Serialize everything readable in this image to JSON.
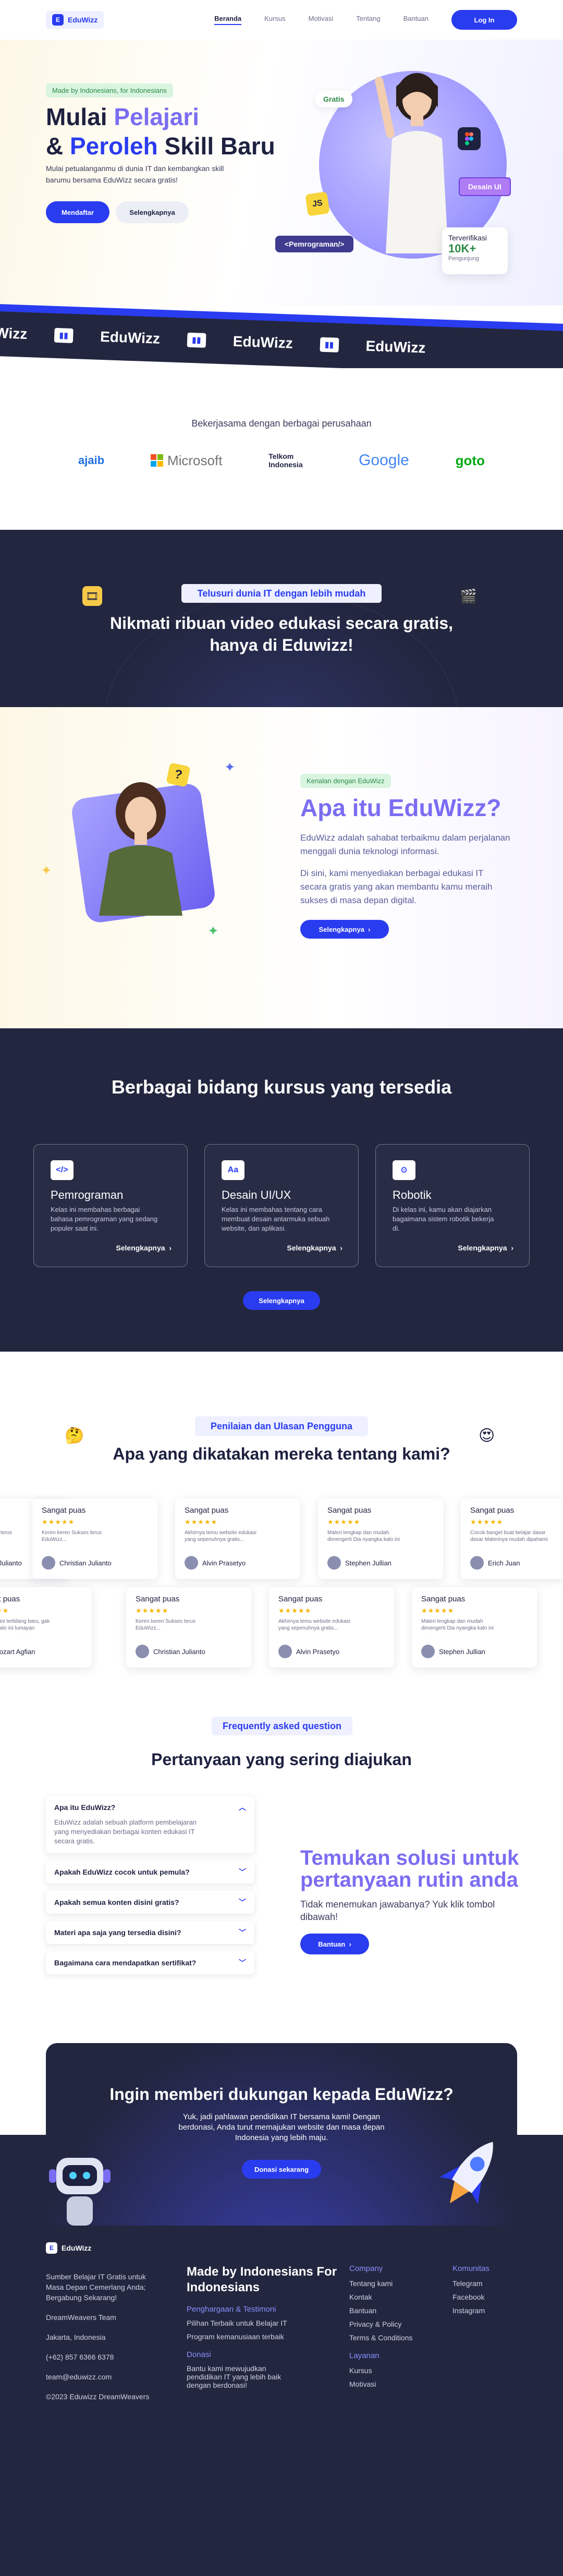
{
  "header": {
    "logo": "EduWizz",
    "nav": [
      "Beranda",
      "Kursus",
      "Motivasi",
      "Tentang",
      "Bantuan"
    ],
    "login": "Log In"
  },
  "hero": {
    "badge": "Made by Indonesians, for Indonesians",
    "title_1a": "Mulai ",
    "title_1b": "Pelajari",
    "title_2a": "& ",
    "title_2b": "Peroleh",
    "title_2c": " Skill Baru",
    "desc": "Mulai petualanganmu di dunia IT dan kembangkan skill barumu bersama EduWizz secara gratis!",
    "btn_primary": "Mendaftar",
    "btn_secondary": "Selengkapnya",
    "tag_gratis": "Gratis",
    "tag_desain": "Desain UI",
    "tag_prog": "<Pemrograman/>",
    "tag_js": "JS",
    "verif_title": "Terverifikasi",
    "verif_number": "10K+",
    "verif_sub": "Pengunjung"
  },
  "band": {
    "word": "EduWizz",
    "partial_left": "Wizz"
  },
  "partners": {
    "title": "Bekerjasama dengan berbagai perusahaan",
    "logos": [
      "ajaib",
      "Microsoft",
      "Telkom Indonesia",
      "Google",
      "goto"
    ]
  },
  "video": {
    "pill": "Telusuri dunia IT dengan lebih mudah",
    "title_1": "Nikmati ribuan video edukasi secara gratis,",
    "title_2": "hanya di Eduwizz!"
  },
  "about": {
    "badge": "Kenalan dengan EduWizz",
    "title": "Apa itu EduWizz?",
    "p1": "EduWizz adalah sahabat terbaikmu dalam perjalanan menggali dunia teknologi informasi.",
    "p2": "Di sini, kami menyediakan berbagai edukasi IT secara gratis yang akan membantu kamu meraih sukses di masa depan digital.",
    "btn": "Selengkapnya"
  },
  "courses": {
    "title": "Berbagai bidang kursus yang tersedia",
    "items": [
      {
        "icon": "</>",
        "title": "Pemrograman",
        "desc": "Kelas ini membahas berbagai bahasa pemrograman yang sedang populer saat ini.",
        "more": "Selengkapnya"
      },
      {
        "icon": "Aa",
        "title": "Desain UI/UX",
        "desc": "Kelas ini membahas tentang cara membuat desain antarmuka sebuah website, dan aplikasi.",
        "more": "Selengkapnya"
      },
      {
        "icon": "⚙",
        "title": "Robotik",
        "desc": "Di kelas ini, kamu akan diajarkan bagaimana sistem robotik bekerja di.",
        "more": "Selengkapnya"
      }
    ],
    "btn": "Selengkapnya"
  },
  "testimonials": {
    "pill": "Penilaian dan Ulasan Pengguna",
    "title": "Apa yang dikatakan mereka tentang kami?",
    "row1": [
      {
        "h": "Sangat puas",
        "b": "Keren keren Sukses terus EduWizz...",
        "u": "Christian Julianto"
      },
      {
        "h": "Sangat puas",
        "b": "Akhirnya temu website edukasi yang sepenuhnya gratis...",
        "u": "Alvin Prasetyo"
      },
      {
        "h": "Sangat puas",
        "b": "Materi lengkap dan mudah dimengerti Dia nyangka kalo ini gratis",
        "u": "Stephen Jullian"
      },
      {
        "h": "Sangat puas",
        "b": "Cocok banget buat belajar dasar dasar Materinya mudah dipahami",
        "u": "Erich Juan"
      }
    ],
    "row2": [
      {
        "h": "Sangat puas",
        "b": "Meskipun ini terbilang baru, gak nyangka kalo ini lumayan dibandingkan yang lain",
        "u": "Mozart Agfian"
      },
      {
        "h": "Sangat puas",
        "b": "Keren keren Sukses terus EduWizz...",
        "u": "Christian Julianto"
      },
      {
        "h": "Sangat puas",
        "b": "Akhirnya temu website edukasi yang sepenuhnya gratis...",
        "u": "Alvin Prasetyo"
      },
      {
        "h": "Sangat puas",
        "b": "Materi lengkap dan mudah dimengerti Dia nyangka kalo ini gratis",
        "u": "Stephen Jullian"
      }
    ],
    "stars": "★★★★★"
  },
  "faq": {
    "pill": "Frequently asked question",
    "title": "Pertanyaan yang sering diajukan",
    "items": [
      {
        "q": "Apa itu EduWizz?",
        "a": "EduWizz adalah sebuah platform pembelajaran yang menyediakan berbagai konten edukasi IT secara gratis."
      },
      {
        "q": "Apakah EduWizz cocok untuk pemula?"
      },
      {
        "q": "Apakah semua konten disini gratis?"
      },
      {
        "q": "Materi apa saja yang tersedia disini?"
      },
      {
        "q": "Bagaimana cara mendapatkan sertifikat?"
      }
    ],
    "side_title": "Temukan solusi untuk pertanyaan rutin anda",
    "side_desc": "Tidak menemukan jawabanya? Yuk klik tombol dibawah!",
    "side_btn": "Bantuan"
  },
  "donate": {
    "title": "Ingin memberi dukungan kepada EduWizz?",
    "desc": "Yuk, jadi pahlawan pendidikan IT bersama kami! Dengan berdonasi, Anda turut memajukan website dan masa depan Indonesia yang lebih maju.",
    "btn": "Donasi sekarang"
  },
  "footer": {
    "logo": "EduWizz",
    "tagline": "Sumber Belajar IT Gratis untuk Masa Depan Cemerlang Anda; Bergabung Sekarang!",
    "team": "DreamWeavers Team",
    "location": "Jakarta, Indonesia",
    "phone": "(+62) 857 6366 6378",
    "email": "team@eduwizz.com",
    "copyright": "©2023 Eduwizz DreamWeavers",
    "headline": "Made by Indonesians For Indonesians",
    "col2_h1": "Penghargaan & Testimoni",
    "col2_l1": "Pilihan Terbaik untuk Belajar IT",
    "col2_l2": "Program kemanusiaan terbaik",
    "col2_h2": "Donasi",
    "col2_l3": "Bantu kami mewujudkan pendidikan IT yang lebih baik dengan berdonasi!",
    "company_title": "Company",
    "company": [
      "Tentang kami",
      "Kontak",
      "Bantuan",
      "Privacy & Policy",
      "Terms & Conditions"
    ],
    "layanan_title": "Layanan",
    "layanan": [
      "Kursus",
      "Motivasi"
    ],
    "community_title": "Komunitas",
    "community": [
      "Telegram",
      "Facebook",
      "Instagram"
    ]
  },
  "colors": {
    "primary": "#2a3cf0",
    "dark": "#22263f",
    "purple": "#7b6df2",
    "green": "#2d8a47"
  }
}
